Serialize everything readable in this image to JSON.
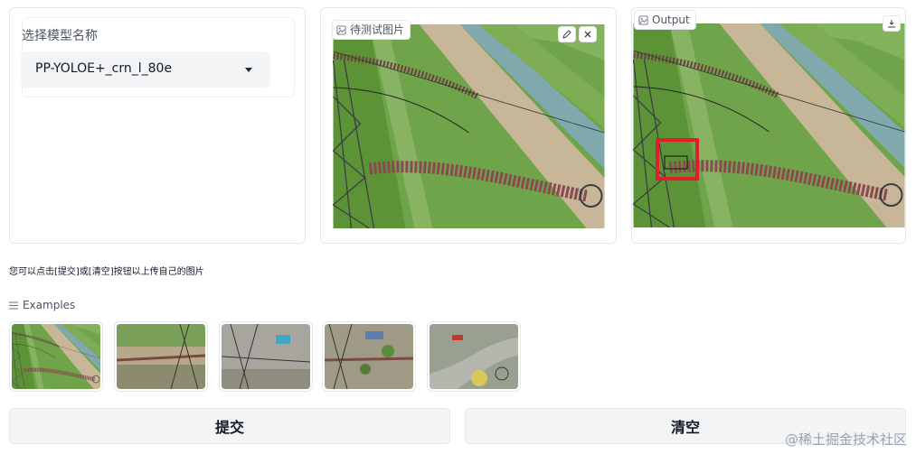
{
  "model": {
    "label": "选择模型名称",
    "selected": "PP-YOLOE+_crn_l_80e"
  },
  "input_image": {
    "label": "待测试图片",
    "icons": [
      "image-icon",
      "edit-icon",
      "close-icon"
    ]
  },
  "output_image": {
    "label": "Output",
    "icons": [
      "image-icon",
      "download-icon"
    ]
  },
  "instruction": "您可以点击[提交]或[清空]按钮以上传自己的图片",
  "examples": {
    "label": "Examples",
    "count": 5
  },
  "buttons": {
    "submit": "提交",
    "clear": "清空"
  },
  "watermark": "@稀土掘金技术社区",
  "colors": {
    "detection_box": "#e11d2e",
    "insulator": "#8b4a4f",
    "field": "#5f9a3c",
    "canal": "#7aa3a8"
  }
}
